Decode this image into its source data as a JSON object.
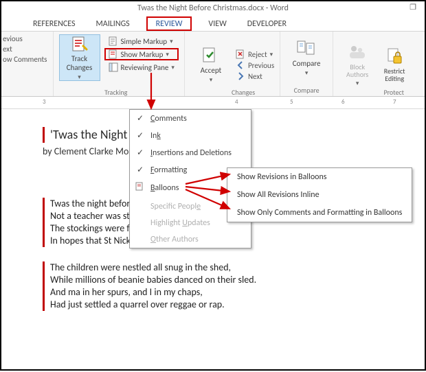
{
  "window": {
    "title": "Twas the Night Before Christmas.docx - Word",
    "restore": "❐"
  },
  "tabs": {
    "references": "REFERENCES",
    "mailings": "MAILINGS",
    "review": "REVIEW",
    "view": "VIEW",
    "developer": "DEVELOPER"
  },
  "ribbon": {
    "comments": {
      "prev": "evious",
      "next": "ext",
      "show": "ow Comments"
    },
    "tracking": {
      "track_changes": "Track Changes",
      "simple_markup": "Simple Markup",
      "show_markup": "Show Markup",
      "reviewing_pane": "Reviewing Pane",
      "group": "Tracking"
    },
    "changes": {
      "accept": "Accept",
      "reject": "Reject",
      "previous": "Previous",
      "next": "Next",
      "group": "Changes"
    },
    "compare": {
      "label": "Compare",
      "group": "Compare"
    },
    "protect": {
      "block": "Block Authors",
      "restrict": "Restrict Editing",
      "group": "Protect"
    }
  },
  "ruler": {
    "n3": "3",
    "n4": "4",
    "n5": "5",
    "n6": "6",
    "n7": "7"
  },
  "showMarkupMenu": {
    "comments": "Comments",
    "ink": "Ink",
    "insdel": "Insertions and Deletions",
    "formatting": "Formatting",
    "balloons": "Balloons",
    "specific": "Specific People",
    "highlight": "Highlight Updates",
    "other": "Other Authors"
  },
  "balloonsMenu": {
    "revballoons": "Show Revisions in Balloons",
    "inline": "Show All Revisions Inline",
    "comments_fmt": "Show Only Comments and Formatting in Balloons"
  },
  "doc": {
    "title": "'Twas the Night be",
    "author": "by Clement Clarke Mo",
    "p1l1": "Twas the night before Christmas, when all through the house",
    "p1l2": "Not a teacher was stirring, not even a spouse.",
    "p1l3": "The stockings were flung by the chimney I swear,",
    "p1l4": " In hopes that St Nick is on Medicare.",
    "p2l1": "The children were nestled all snug in the shed,",
    "p2l2": "While millions of beanie babies danced on their sled.",
    "p2l3": "And ma in her spurs, and I in my chaps,",
    "p2l4": "Had just settled a quarrel over reggae or rap."
  }
}
